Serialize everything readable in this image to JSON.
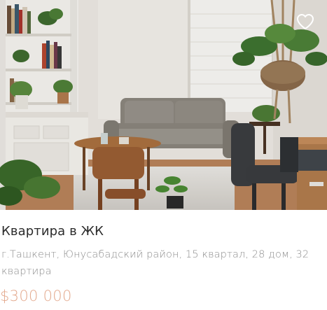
{
  "listing": {
    "title": "Квартира в ЖК",
    "address": "г.Ташкент, Юнусабадский район, 15 квартал, 28 дом, 32 квартира",
    "price": "$300 000",
    "favorite_icon": "heart-outline-icon",
    "photo_alt": "Интерьер квартиры"
  },
  "colors": {
    "price": "#e3a88c",
    "title": "#2b2b2b",
    "address": "#8e8e8e",
    "favorite_icon": "#ffffff"
  }
}
